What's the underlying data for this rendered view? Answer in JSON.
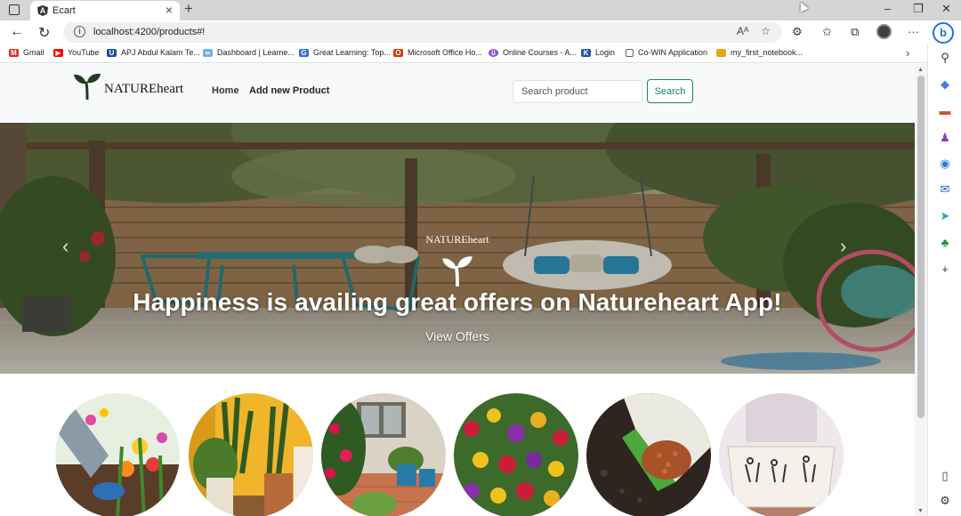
{
  "browser": {
    "tab_title": "Ecart",
    "url": "localhost:4200/products#!",
    "bookmarks": [
      {
        "label": "Gmail",
        "icon": "gmail-icon",
        "color": "#d93025"
      },
      {
        "label": "YouTube",
        "icon": "youtube-icon",
        "color": "#ff0000"
      },
      {
        "label": "APJ Abdul Kalam Te...",
        "icon": "university-icon",
        "color": "#1a4e9a"
      },
      {
        "label": "Dashboard | Learne...",
        "icon": "cloud-icon",
        "color": "#6fb3e0"
      },
      {
        "label": "Great Learning: Top...",
        "icon": "g-icon",
        "color": "#2e6fd8"
      },
      {
        "label": "Microsoft Office Ho...",
        "icon": "office-icon",
        "color": "#d83b01"
      },
      {
        "label": "Online Courses - A...",
        "icon": "udemy-icon",
        "color": "#8a4fd8"
      },
      {
        "label": "Login",
        "icon": "login-icon",
        "color": "#1e5aa8"
      },
      {
        "label": "Co-WIN Application",
        "icon": "document-icon",
        "color": "#666666"
      },
      {
        "label": "my_first_notebook...",
        "icon": "notebook-icon",
        "color": "#e8a317"
      }
    ]
  },
  "navbar": {
    "brand": "NATUREheart",
    "links": [
      "Home",
      "Add new Product"
    ],
    "search_placeholder": "Search product",
    "search_button": "Search",
    "accent": "#198754"
  },
  "hero": {
    "brand": "NATUREheart",
    "title": "Happiness is availing great offers on Natureheart App!",
    "cta": "View Offers"
  },
  "categories": [
    {
      "name": "gardening-gloves-flowers"
    },
    {
      "name": "indoor-potted-plants"
    },
    {
      "name": "patio-flower-pots"
    },
    {
      "name": "flower-bed"
    },
    {
      "name": "soil-and-seeds"
    },
    {
      "name": "ceramic-planter"
    }
  ]
}
